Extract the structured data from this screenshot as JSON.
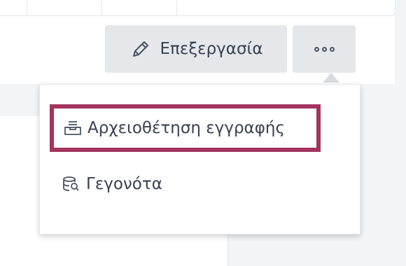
{
  "toolbar": {
    "edit_label": "Επεξεργασία",
    "edit_icon": "pencil-icon",
    "more_icon": "more-dots-icon"
  },
  "menu": {
    "items": [
      {
        "label": "Αρχειοθέτηση εγγραφής",
        "icon": "archive-icon",
        "highlighted": true
      },
      {
        "label": "Γεγονότα",
        "icon": "events-search-icon",
        "highlighted": false
      }
    ]
  },
  "colors": {
    "highlight_border": "#a3335f",
    "button_bg": "#e5e7eb",
    "page_bg": "#f3f4f6",
    "text": "#374151"
  }
}
